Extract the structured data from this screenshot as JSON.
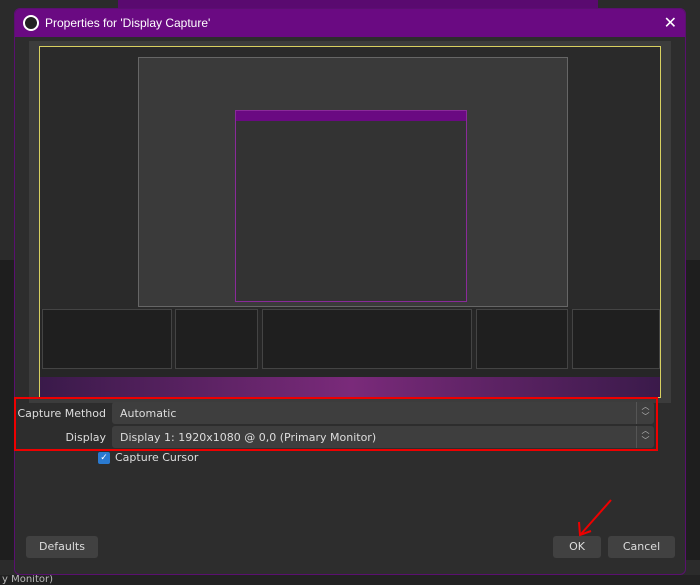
{
  "window": {
    "title": "Properties for 'Display Capture'"
  },
  "form": {
    "capture_method": {
      "label": "Capture Method",
      "value": "Automatic"
    },
    "display": {
      "label": "Display",
      "value": "Display 1: 1920x1080 @ 0,0 (Primary Monitor)"
    },
    "capture_cursor": {
      "label": "Capture Cursor",
      "checked": true
    }
  },
  "buttons": {
    "defaults": "Defaults",
    "ok": "OK",
    "cancel": "Cancel"
  },
  "background": {
    "status_fragment": "y Monitor)"
  },
  "colors": {
    "titlebar": "#6a0a82",
    "highlight": "#e00000",
    "checkbox": "#2a7ad0"
  }
}
